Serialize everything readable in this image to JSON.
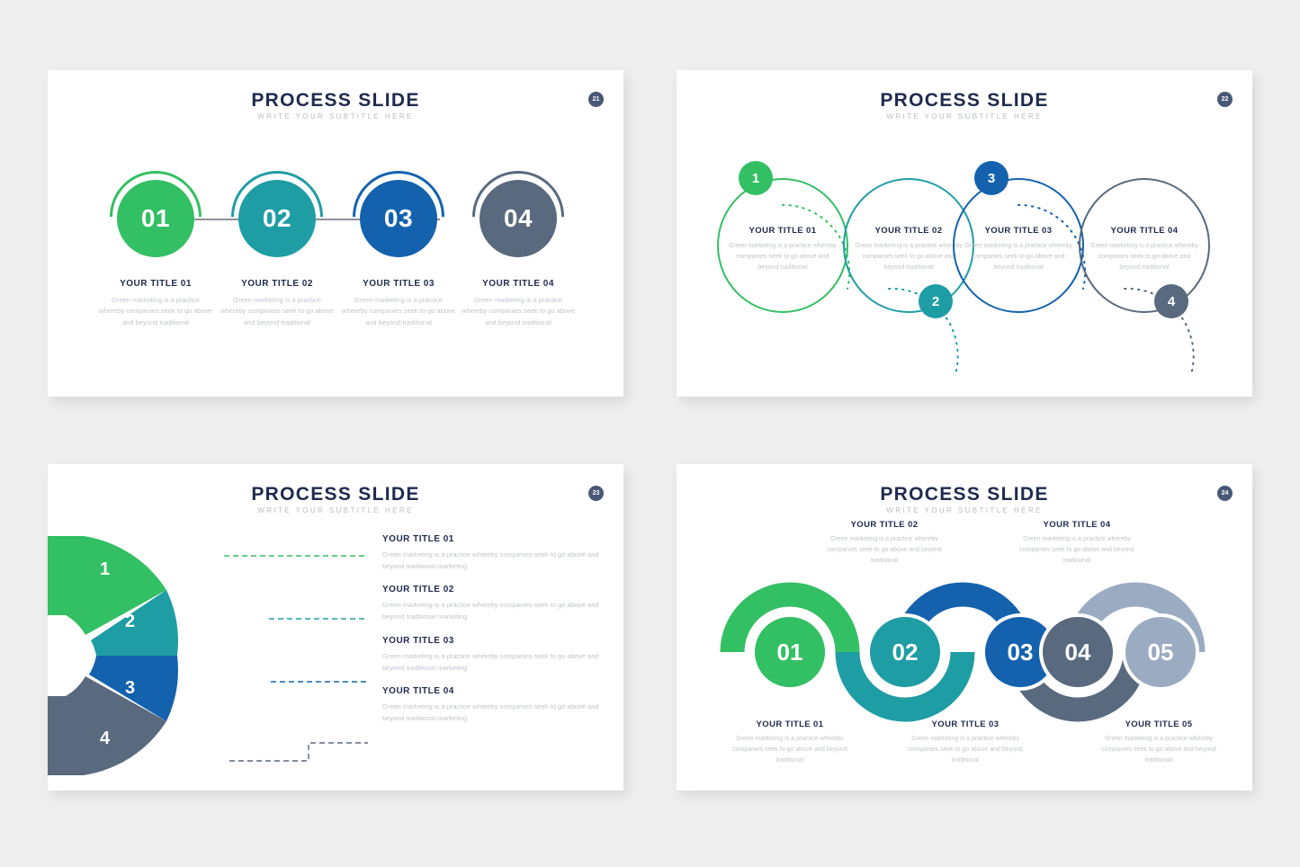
{
  "background_color": "#efefef",
  "palette": {
    "green": "#33bf63",
    "teal": "#1f9da5",
    "blue": "#1462ae",
    "slate": "#59697e",
    "light_slate": "#9bacc2",
    "navy_text": "#1f2a4d",
    "muted_text": "#c2c5cc",
    "subtitle": "#b9bcc4",
    "badge_bg": "#4a5878",
    "connector": "#8e9099"
  },
  "slides": [
    {
      "id": "slide-1",
      "title": "PROCESS SLIDE",
      "subtitle": "WRITE YOUR SUBTITLE HERE",
      "page_number": "21",
      "layout": "linked-circles",
      "steps": [
        {
          "number": "01",
          "title": "YOUR TITLE 01",
          "body": "Green marketing is a practice whereby companies seek to go above and beyond traditional",
          "color": "#33bf63"
        },
        {
          "number": "02",
          "title": "YOUR TITLE 02",
          "body": "Green marketing is a practice whereby companies seek to go above and beyond traditional",
          "color": "#1f9da5"
        },
        {
          "number": "03",
          "title": "YOUR TITLE 03",
          "body": "Green marketing is a practice whereby companies seek to go above and beyond traditional",
          "color": "#1462ae"
        },
        {
          "number": "04",
          "title": "YOUR TITLE 04",
          "body": "Green marketing is a practice whereby companies seek to go above and beyond traditional",
          "color": "#59697e"
        }
      ]
    },
    {
      "id": "slide-2",
      "title": "PROCESS SLIDE",
      "subtitle": "WRITE YOUR SUBTITLE HERE",
      "page_number": "22",
      "layout": "outline-circles-dotted",
      "steps": [
        {
          "number": "1",
          "title": "YOUR TITLE 01",
          "body": "Green marketing is a practice whereby companies seek to go above and beyond traditional",
          "color": "#33bf63",
          "badge_position": "top"
        },
        {
          "number": "2",
          "title": "YOUR TITLE 02",
          "body": "Green marketing is a practice whereby companies seek to go above and beyond traditional",
          "color": "#1f9da5",
          "badge_position": "bottom"
        },
        {
          "number": "3",
          "title": "YOUR TITLE 03",
          "body": "Green marketing is a practice whereby companies seek to go above and beyond traditional",
          "color": "#1462ae",
          "badge_position": "top"
        },
        {
          "number": "4",
          "title": "YOUR TITLE 04",
          "body": "Green marketing is a practice whereby companies seek to go above and beyond traditional",
          "color": "#59697e",
          "badge_position": "bottom"
        }
      ]
    },
    {
      "id": "slide-3",
      "title": "PROCESS SLIDE",
      "subtitle": "WRITE YOUR SUBTITLE HERE",
      "page_number": "23",
      "layout": "d-shape-donut",
      "steps": [
        {
          "number": "1",
          "title": "YOUR TITLE 01",
          "body": "Green marketing is a practice whereby companies seek to go above and beyond traditional marketing",
          "color": "#33bf63"
        },
        {
          "number": "2",
          "title": "YOUR TITLE 02",
          "body": "Green marketing is a practice whereby companies seek to go above and beyond traditional marketing",
          "color": "#1f9da5"
        },
        {
          "number": "3",
          "title": "YOUR TITLE 03",
          "body": "Green marketing is a practice whereby companies seek to go above and beyond traditional marketing",
          "color": "#1462ae"
        },
        {
          "number": "4",
          "title": "YOUR TITLE 04",
          "body": "Green marketing is a practice whereby companies seek to go above and beyond traditional marketing",
          "color": "#59697e"
        }
      ]
    },
    {
      "id": "slide-4",
      "title": "PROCESS SLIDE",
      "subtitle": "WRITE YOUR SUBTITLE HERE",
      "page_number": "24",
      "layout": "serpentine-chain",
      "steps": [
        {
          "number": "01",
          "title": "YOUR TITLE 01",
          "body": "Green marketing is a practice whereby companies seek to go above and beyond traditional",
          "color": "#33bf63",
          "caption_position": "bottom"
        },
        {
          "number": "02",
          "title": "YOUR TITLE 02",
          "body": "Green marketing is a practice whereby companies seek to go above and beyond traditional",
          "color": "#1f9da5",
          "caption_position": "top"
        },
        {
          "number": "03",
          "title": "YOUR TITLE 03",
          "body": "Green marketing is a practice whereby companies seek to go above and beyond traditional",
          "color": "#1462ae",
          "caption_position": "bottom"
        },
        {
          "number": "04",
          "title": "YOUR TITLE 04",
          "body": "Green marketing is a practice whereby companies seek to go above and beyond traditional",
          "color": "#59697e",
          "caption_position": "top"
        },
        {
          "number": "05",
          "title": "YOUR TITLE 05",
          "body": "Green marketing is a practice whereby companies seek to go above and beyond traditional",
          "color": "#9bacc2",
          "caption_position": "bottom"
        }
      ]
    }
  ]
}
